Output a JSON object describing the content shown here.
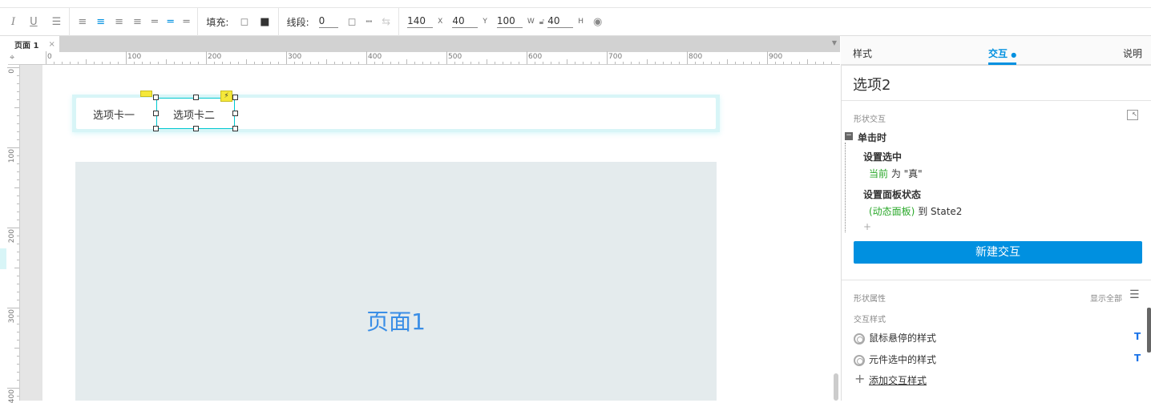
{
  "toolbar": {
    "fill_label": "填充:",
    "stroke_label": "线段:",
    "stroke_value": "0",
    "x_value": "140",
    "x_unit": "X",
    "y_value": "40",
    "y_unit": "Y",
    "w_value": "100",
    "w_unit": "W",
    "h_value": "40",
    "h_unit": "H"
  },
  "page_tab": {
    "label": "页面 1",
    "close": "×"
  },
  "ruler": {
    "h": [
      "0",
      "100",
      "200",
      "300",
      "400",
      "500",
      "600",
      "700",
      "800",
      "900"
    ],
    "v": [
      "0",
      "100",
      "200",
      "300",
      "400"
    ]
  },
  "canvas": {
    "tab1": "选项卡一",
    "tab2": "选项卡二",
    "panel_label": "页面1"
  },
  "right": {
    "tabs": [
      "样式",
      "交互",
      "说明"
    ],
    "title": "选项2",
    "shape_interaction": "形状交互",
    "event": "单击时",
    "actions": [
      {
        "name": "设置选中",
        "target": "当前",
        "rest": "为 \"真\""
      },
      {
        "name": "设置面板状态",
        "target": "(动态面板)",
        "rest": "到 State2"
      }
    ],
    "add": "+",
    "new_btn": "新建交互",
    "shape_props": "形状属性",
    "show_all": "显示全部",
    "interaction_styles": "交互样式",
    "styles": [
      {
        "label": "鼠标悬停的样式",
        "t": "T"
      },
      {
        "label": "元件选中的样式",
        "t": "T"
      }
    ],
    "add_style": "添加交互样式"
  },
  "colors": {
    "accent": "#0090e0",
    "green": "#2aa82a",
    "selection": "#00c8d0"
  }
}
